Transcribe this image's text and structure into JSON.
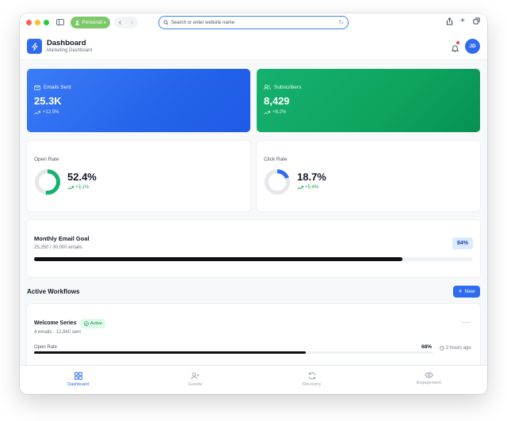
{
  "browser": {
    "profile_label": "Personal",
    "address_placeholder": "Search or enter website name"
  },
  "header": {
    "title": "Dashboard",
    "subtitle": "Marketing Dashboard",
    "avatar_initials": "JD",
    "has_notification": true
  },
  "stats": [
    {
      "label": "Emails Sent",
      "value": "25.3K",
      "change": "+12.5%",
      "icon": "mail-icon"
    },
    {
      "label": "Subscribers",
      "value": "8,429",
      "change": "+8.2%",
      "icon": "users-icon"
    }
  ],
  "rates": [
    {
      "label": "Open Rate",
      "value": "52.4%",
      "change": "+3.1%",
      "percent": 52.4,
      "color": "#16b36f"
    },
    {
      "label": "Click Rate",
      "value": "18.7%",
      "change": "+5.4%",
      "percent": 18.7,
      "color": "#2f6bf1"
    }
  ],
  "goal": {
    "title": "Monthly Email Goal",
    "progress_text": "25,350 / 30,000 emails",
    "percent_label": "84%",
    "percent": 84
  },
  "workflows": {
    "section_title": "Active Workflows",
    "new_label": "New",
    "items": [
      {
        "title": "Welcome Series",
        "status": "Active",
        "meta": "4 emails · 12,840 sent",
        "rate_label": "Open Rate",
        "rate_value": "68%",
        "rate_percent": 68,
        "time": "2 hours ago"
      }
    ]
  },
  "bottom_nav": [
    {
      "label": "Dashboard",
      "icon": "grid-icon",
      "active": true
    },
    {
      "label": "Guests",
      "icon": "user-plus-icon",
      "active": false
    },
    {
      "label": "Recovery",
      "icon": "refresh-icon",
      "active": false
    },
    {
      "label": "Engagement",
      "icon": "eye-icon",
      "active": false
    }
  ],
  "colors": {
    "accent": "#2f6bf1",
    "success": "#16b36f"
  }
}
